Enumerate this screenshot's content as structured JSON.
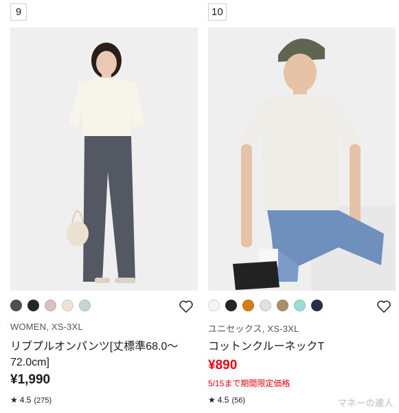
{
  "products": [
    {
      "rank": "9",
      "swatches": [
        "#4b5058",
        "#262626",
        "#dcc0c0",
        "#ece2d7",
        "#c7d7cc"
      ],
      "meta": "WOMEN, XS-3XL",
      "name": "リブプルオンパンツ[丈標準68.0〜72.0cm]",
      "price": "¥1,990",
      "promo": "",
      "rating": "4.5",
      "review_count": "(275)"
    },
    {
      "rank": "10",
      "swatches": [
        "#f5f5f5",
        "#262626",
        "#d37d14",
        "#e1e1e1",
        "#a8906a",
        "#9ddcd1",
        "#283049"
      ],
      "meta": "ユニセックス, XS-3XL",
      "name": "コットンクルーネックT",
      "price": "¥890",
      "promo": "5/15まで期間限定価格",
      "rating": "4.5",
      "review_count": "(56)"
    }
  ],
  "watermark": "マネーの達人",
  "icons": {
    "favorite": "heart-outline-icon",
    "rating": "star-icon"
  }
}
